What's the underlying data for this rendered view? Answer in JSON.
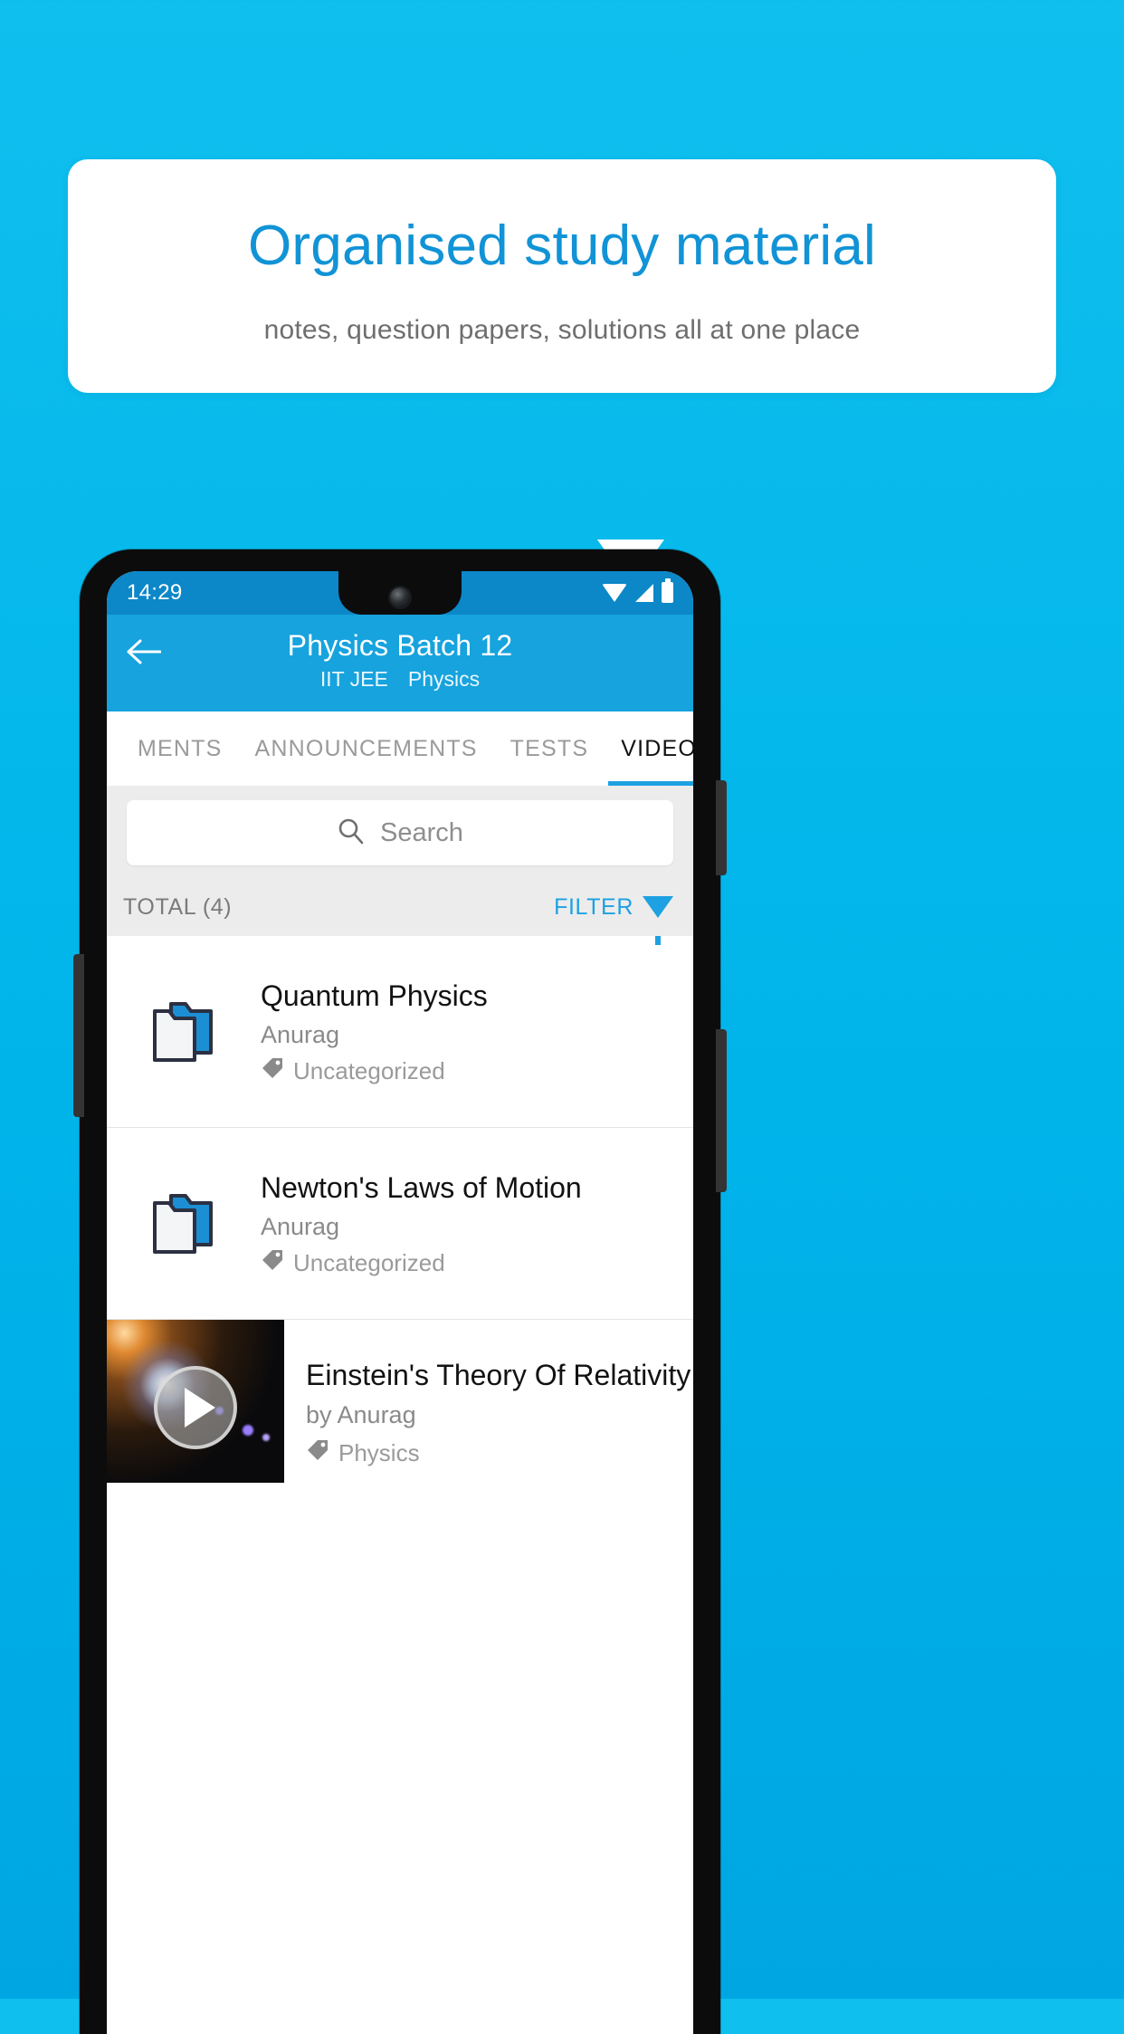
{
  "promo": {
    "title": "Organised study material",
    "subtitle": "notes, question papers, solutions all at one place",
    "title_color": "#1193D6",
    "background_color": "#00B4EA"
  },
  "phone": {
    "status_bar": {
      "time": "14:29",
      "icons": [
        "wifi-icon",
        "signal-icon",
        "battery-icon"
      ]
    },
    "app_bar": {
      "back_icon": "back-arrow-icon",
      "title": "Physics Batch 12",
      "subtitle_course": "IIT JEE",
      "subtitle_subject": "Physics",
      "accent_color": "#16A3DE"
    },
    "tabs": [
      {
        "label": "MENTS",
        "active": false
      },
      {
        "label": "ANNOUNCEMENTS",
        "active": false
      },
      {
        "label": "TESTS",
        "active": false
      },
      {
        "label": "VIDEOS",
        "active": true
      }
    ],
    "search": {
      "placeholder": "Search",
      "icon": "search-icon"
    },
    "toolbar": {
      "total_label": "TOTAL (4)",
      "filter_label": "FILTER",
      "filter_icon": "filter-funnel-icon",
      "filter_color": "#1DA1E2"
    },
    "items": [
      {
        "type": "folder",
        "icon": "folder-icon",
        "title": "Quantum Physics",
        "author": "Anurag",
        "tag": "Uncategorized",
        "tag_icon": "tag-icon"
      },
      {
        "type": "folder",
        "icon": "folder-icon",
        "title": "Newton's Laws of Motion",
        "author": "Anurag",
        "tag": "Uncategorized",
        "tag_icon": "tag-icon"
      },
      {
        "type": "video",
        "icon": "play-icon",
        "title": "Einstein's Theory Of Relativity",
        "author": "by Anurag",
        "tag": "Physics",
        "tag_icon": "tag-icon"
      }
    ]
  }
}
